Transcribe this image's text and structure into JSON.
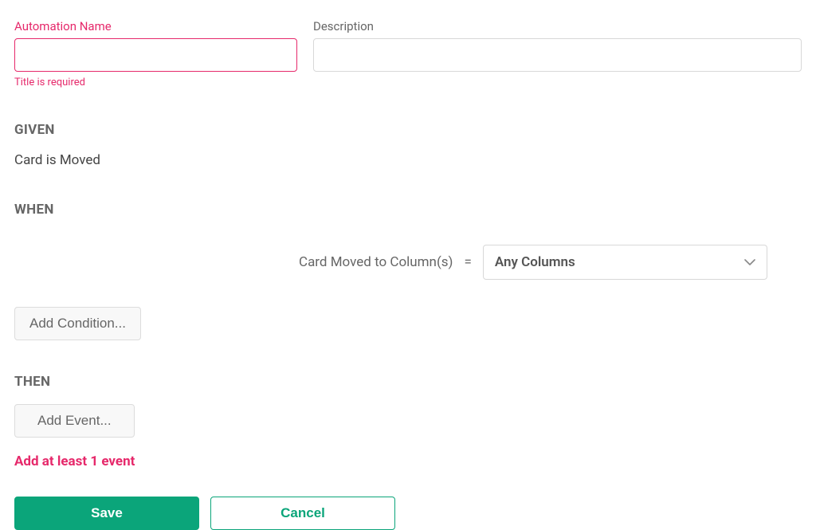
{
  "form": {
    "name": {
      "label": "Automation Name",
      "value": "",
      "error": "Title is required"
    },
    "description": {
      "label": "Description",
      "value": ""
    }
  },
  "sections": {
    "given": {
      "label": "GIVEN",
      "trigger": "Card is Moved"
    },
    "when": {
      "label": "WHEN",
      "condition": {
        "field": "Card Moved to Column(s)",
        "operator": "=",
        "value": "Any Columns"
      },
      "add_button": "Add Condition..."
    },
    "then": {
      "label": "THEN",
      "add_button": "Add Event...",
      "error": "Add at least 1 event"
    }
  },
  "actions": {
    "save": "Save",
    "cancel": "Cancel"
  }
}
